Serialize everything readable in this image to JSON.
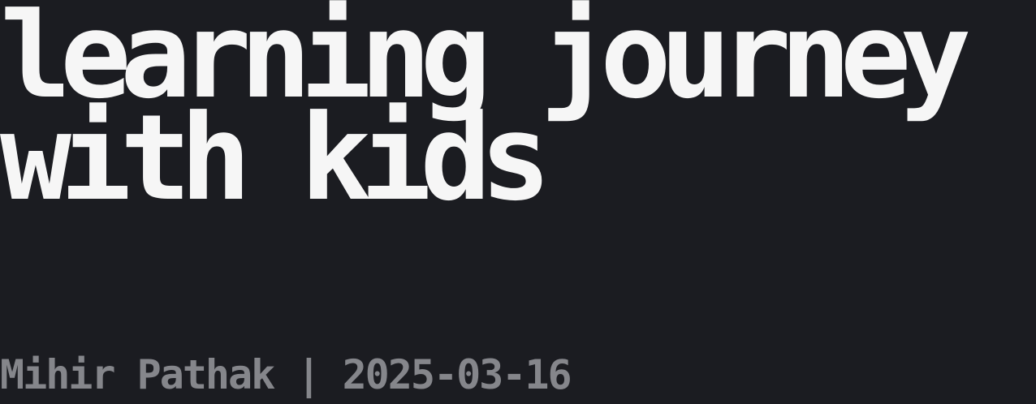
{
  "post": {
    "title_line_1": "learning journey",
    "title_line_2": "with kids",
    "author": "Mihir Pathak",
    "separator": "|",
    "date": "2025-03-16"
  },
  "colors": {
    "background": "#1b1c21",
    "title_text": "#f6f6f6",
    "meta_text": "#85868b"
  }
}
